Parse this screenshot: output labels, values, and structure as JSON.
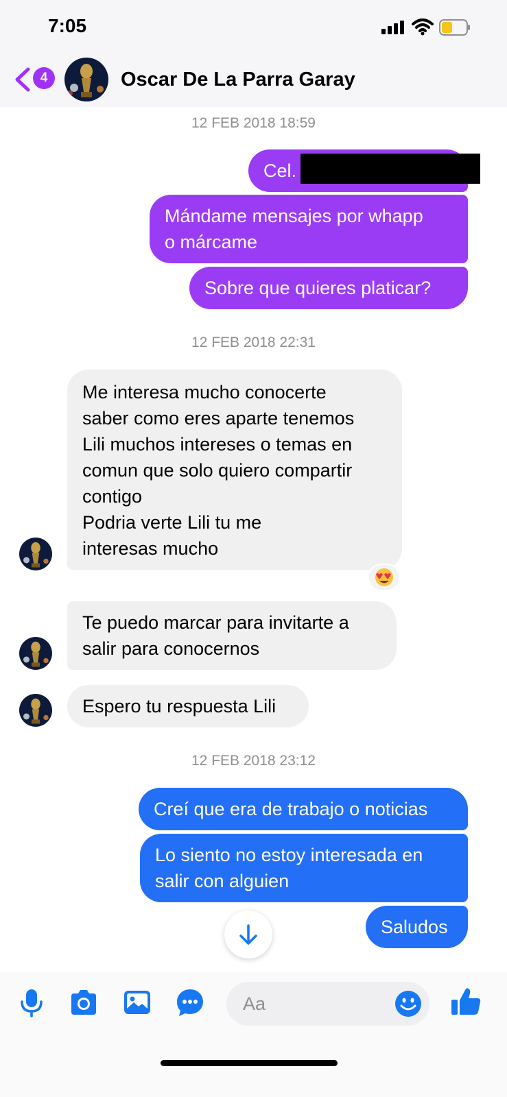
{
  "status_bar": {
    "time": "7:05"
  },
  "header": {
    "back_badge": "4",
    "contact_name": "Oscar De La Parra Garay"
  },
  "conversation": {
    "timestamps": [
      "12 FEB 2018 18:59",
      "12 FEB 2018 22:31",
      "12 FEB 2018 23:12"
    ],
    "messages": [
      {
        "sender": "me",
        "lines": [
          "Cel."
        ]
      },
      {
        "sender": "me",
        "lines": [
          "Mándame mensajes por whapp",
          "o márcame"
        ]
      },
      {
        "sender": "me",
        "lines": [
          "Sobre que quieres platicar?"
        ]
      },
      {
        "sender": "contact",
        "lines": [
          "Me interesa mucho conocerte",
          "saber como eres aparte tenemos",
          "Lili muchos intereses o temas en",
          "comun que solo quiero compartir",
          "contigo",
          "Podria verte Lili tu me",
          "interesas mucho"
        ],
        "reaction": "😍"
      },
      {
        "sender": "contact",
        "lines": [
          "Te puedo marcar para invitarte a",
          "salir para conocernos"
        ]
      },
      {
        "sender": "contact",
        "lines": [
          "Espero tu respuesta Lili"
        ]
      },
      {
        "sender": "me",
        "lines": [
          "Creí que era de trabajo o noticias"
        ]
      },
      {
        "sender": "me",
        "lines": [
          "Lo siento no estoy interesada en",
          "salir con alguien"
        ]
      },
      {
        "sender": "me",
        "lines": [
          "Saludos"
        ]
      }
    ]
  },
  "composer": {
    "placeholder": "Aa",
    "icons": [
      "microphone-icon",
      "camera-icon",
      "gallery-icon",
      "chat-bubble-icon",
      "emoji-icon",
      "thumbs-up-icon"
    ]
  },
  "colors": {
    "purple_bubble": "#9b3cf5",
    "blue_bubble": "#236ff5",
    "incoming_bubble": "#f0f0f0",
    "accent_blue": "#1778f2",
    "badge_purple": "#a032f5"
  }
}
